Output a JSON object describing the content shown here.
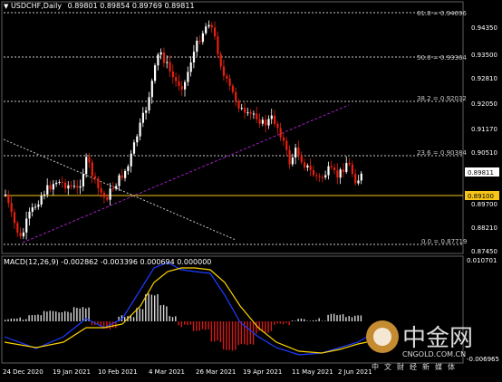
{
  "header": {
    "menu_icon": "triangle-down-icon",
    "symbol": "USDCHF,Daily",
    "ohlc": "0.89801 0.89854 0.89769 0.89811"
  },
  "price_axis": {
    "ticks": [
      "0.94350",
      "0.93500",
      "0.92810",
      "0.92050",
      "0.91170",
      "0.90510",
      "0.89700",
      "0.88210",
      "0.87450"
    ],
    "current_price": "0.89811",
    "line_price": "0.89100"
  },
  "fibonacci": [
    {
      "label": "61.8 = 0.94696"
    },
    {
      "label": "50.0 = 0.93364"
    },
    {
      "label": "38.2 = 0.92032"
    },
    {
      "label": "23.6 = 0.90384"
    },
    {
      "label": "0.0 = 0.87719"
    }
  ],
  "macd": {
    "label": "MACD(12,26,9) -0.002862 -0.003396 0.000694 0.000000",
    "ticks": [
      "0.010701",
      "-0.006965"
    ]
  },
  "time_axis": [
    "24 Dec 2020",
    "19 Jan 2021",
    "10 Feb 2021",
    "4 Mar 2021",
    "26 Mar 2021",
    "19 Apr 2021",
    "11 May 2021",
    "2 Jun 2021"
  ],
  "watermark": {
    "brand": "中金网",
    "url": "CNGOLD.COM.CN",
    "tagline": "中文财经新媒体"
  },
  "colors": {
    "bull": "#ffffff",
    "bear": "#e8200f",
    "fib": "#c8c8c8",
    "horizontal_line": "#f5c518",
    "trendline": "#a020c0",
    "macd_line": "#1e3cff",
    "signal_line": "#ffd400",
    "hist_pos": "#d8d8d8",
    "hist_neg": "#d41a1a"
  }
}
